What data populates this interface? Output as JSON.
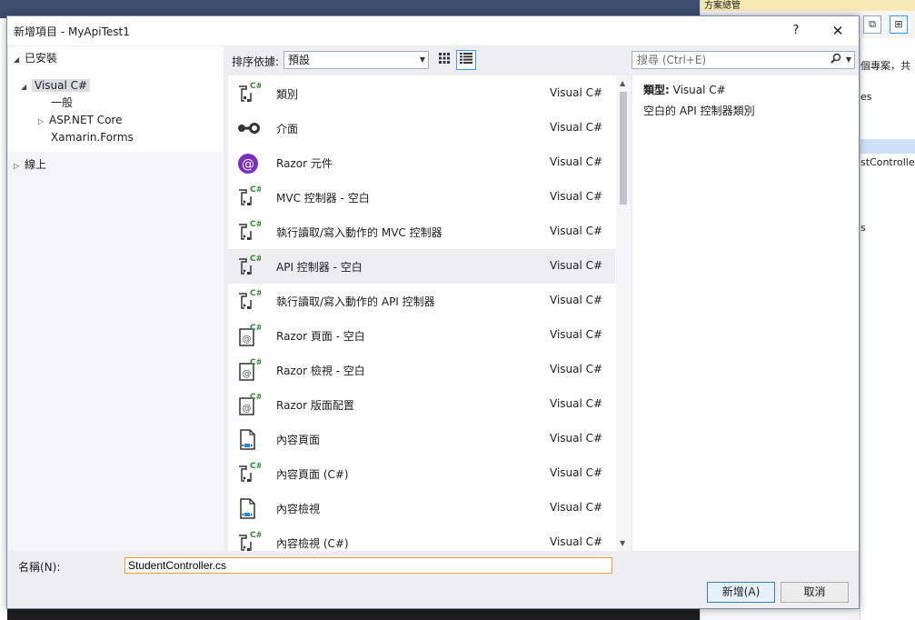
{
  "dialog": {
    "title": "新增項目 - MyApiTest1",
    "help": "?",
    "close": "✕"
  },
  "tree": {
    "installed": "已安裝",
    "visual_csharp": "Visual C#",
    "general": "一般",
    "aspnet_core": "ASP.NET Core",
    "xamarin_forms": "Xamarin.Forms",
    "online": "線上"
  },
  "toolbar": {
    "sort_label": "排序依據:",
    "sort_value": "預設",
    "search_placeholder": "搜尋 (Ctrl+E)"
  },
  "templates": [
    {
      "name": "類別",
      "lang": "Visual C#",
      "icon": "class-icon"
    },
    {
      "name": "介面",
      "lang": "Visual C#",
      "icon": "interface-icon"
    },
    {
      "name": "Razor 元件",
      "lang": "Visual C#",
      "icon": "razor-component-icon"
    },
    {
      "name": "MVC 控制器 - 空白",
      "lang": "Visual C#",
      "icon": "controller-icon"
    },
    {
      "name": "執行讀取/寫入動作的 MVC 控制器",
      "lang": "Visual C#",
      "icon": "controller-icon"
    },
    {
      "name": "API 控制器 - 空白",
      "lang": "Visual C#",
      "icon": "controller-icon",
      "selected": true
    },
    {
      "name": "執行讀取/寫入動作的 API 控制器",
      "lang": "Visual C#",
      "icon": "controller-icon"
    },
    {
      "name": "Razor 頁面 - 空白",
      "lang": "Visual C#",
      "icon": "razor-page-icon"
    },
    {
      "name": "Razor 檢視 - 空白",
      "lang": "Visual C#",
      "icon": "razor-page-icon"
    },
    {
      "name": "Razor 版面配置",
      "lang": "Visual C#",
      "icon": "razor-page-icon"
    },
    {
      "name": "內容頁面",
      "lang": "Visual C#",
      "icon": "content-page-icon"
    },
    {
      "name": "內容頁面 (C#)",
      "lang": "Visual C#",
      "icon": "controller-icon"
    },
    {
      "name": "內容檢視",
      "lang": "Visual C#",
      "icon": "content-page-icon"
    },
    {
      "name": "內容檢視 (C#)",
      "lang": "Visual C#",
      "icon": "controller-icon"
    }
  ],
  "details": {
    "type_key": "類型:",
    "type_value": "Visual C#",
    "description": "空白的 API 控制器類別"
  },
  "footer": {
    "name_label": "名稱(N):",
    "name_value": "StudentController.cs",
    "add_button": "新增(A)",
    "cancel_button": "取消"
  },
  "background": {
    "right_header": "方案總管",
    "right_rows": [
      "個專案，共",
      "es",
      "stControlle",
      "s"
    ]
  }
}
